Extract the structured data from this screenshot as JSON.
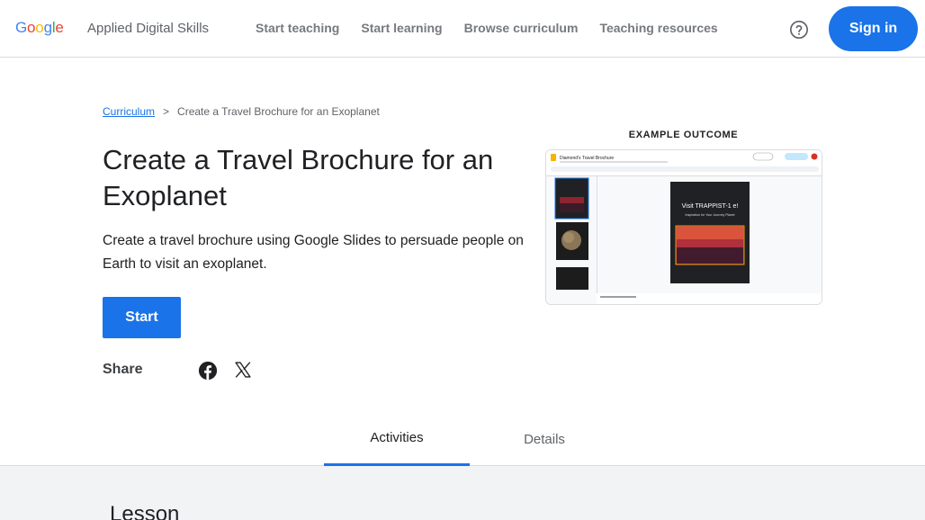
{
  "header": {
    "logo_letters": [
      {
        "ch": "G",
        "color": "#4285f4"
      },
      {
        "ch": "o",
        "color": "#ea4335"
      },
      {
        "ch": "o",
        "color": "#fbbc05"
      },
      {
        "ch": "g",
        "color": "#4285f4"
      },
      {
        "ch": "l",
        "color": "#34a853"
      },
      {
        "ch": "e",
        "color": "#ea4335"
      }
    ],
    "product_name": "Applied Digital Skills",
    "nav": [
      "Start teaching",
      "Start learning",
      "Browse curriculum",
      "Teaching resources"
    ],
    "help_icon": "help-circle-icon",
    "signin_label": "Sign in"
  },
  "breadcrumb": {
    "link": "Curriculum",
    "separator": ">",
    "current": "Create a Travel Brochure for an Exoplanet"
  },
  "lesson": {
    "title": "Create a Travel Brochure for an Exoplanet",
    "description": "Create a travel brochure using Google Slides to persuade people on Earth to visit an exoplanet.",
    "start_label": "Start",
    "share_label": "Share",
    "share_icons": [
      "facebook-icon",
      "x-icon"
    ]
  },
  "example_outcome": {
    "label": "EXAMPLE OUTCOME",
    "doc_title": "Diamond's Travel Brochure",
    "slide_title": "Visit TRAPPIST-1 e!",
    "slide_subtitle": "Inspiration for Your Journey Planet"
  },
  "tabs": [
    "Activities",
    "Details"
  ],
  "section_heading": "Lesson",
  "colors": {
    "accent": "#1a73e8",
    "text": "#202124",
    "muted": "#5f6368"
  }
}
